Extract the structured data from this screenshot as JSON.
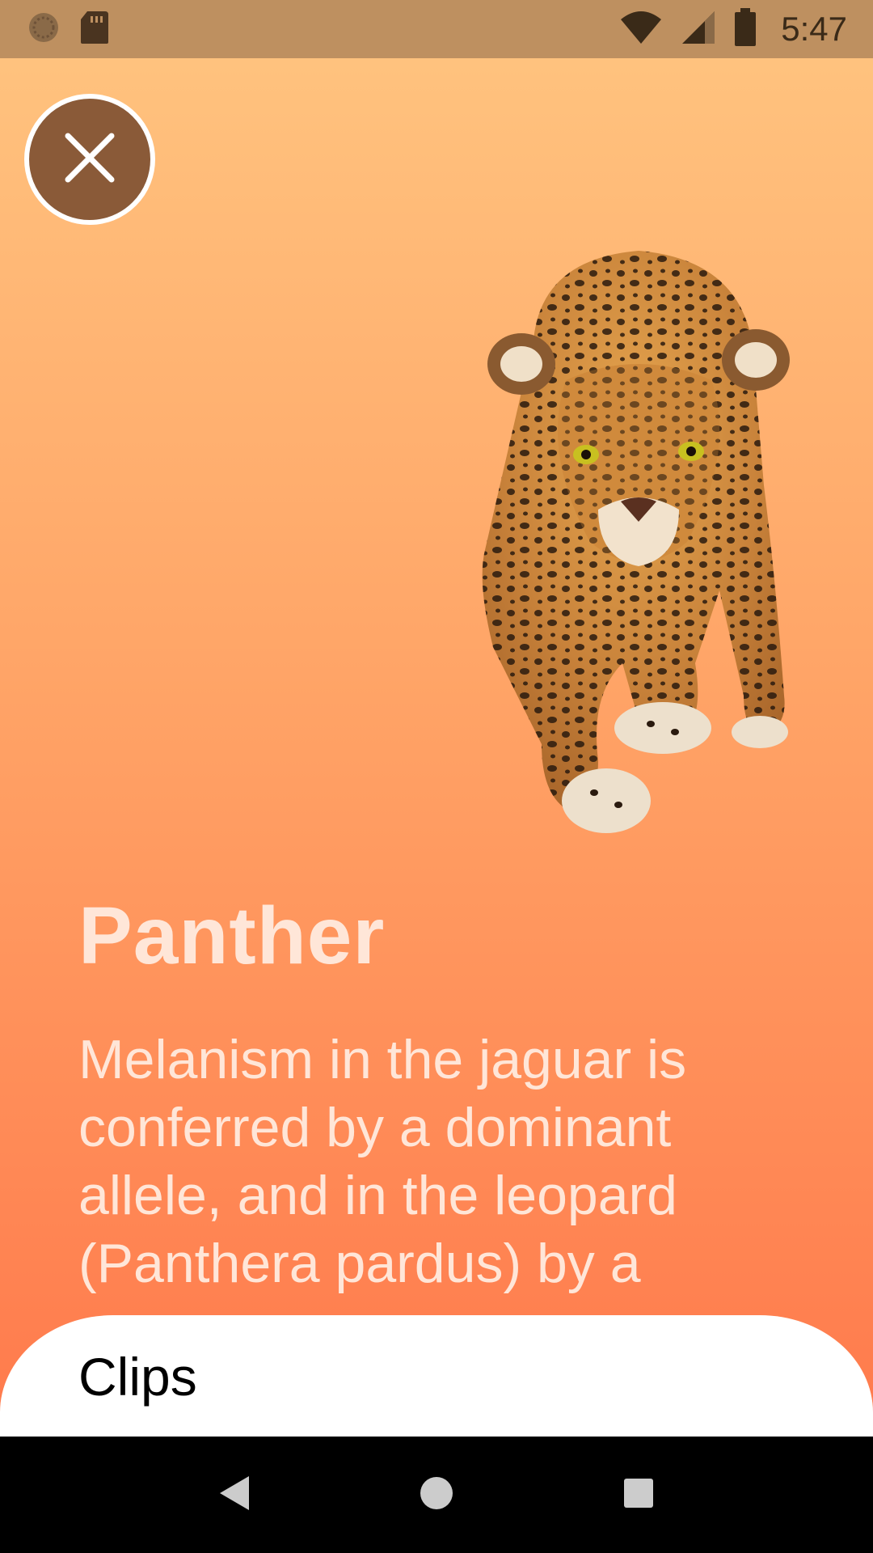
{
  "status_bar": {
    "time": "5:47",
    "left_icons": [
      "sync-icon",
      "sd-card-icon"
    ],
    "right_icons": [
      "wifi-icon",
      "signal-icon",
      "battery-icon"
    ]
  },
  "close_button": {
    "icon": "close-icon"
  },
  "animal": {
    "name": "Panther",
    "description": "Melanism in the jaguar is conferred by a dominant allele, and in the leopard (Panthera pardus) by a",
    "image_icon": "jaguar-illustration"
  },
  "sheet": {
    "label": "Clips"
  },
  "nav_bar": {
    "buttons": [
      "back-icon",
      "home-icon",
      "recents-icon"
    ]
  },
  "colors": {
    "gradient_top": "#FFC580",
    "gradient_bottom": "#FF7448",
    "status_bar": "#BE9060",
    "close_button": "#8A5A38",
    "title_text": "#FFE6D8"
  }
}
